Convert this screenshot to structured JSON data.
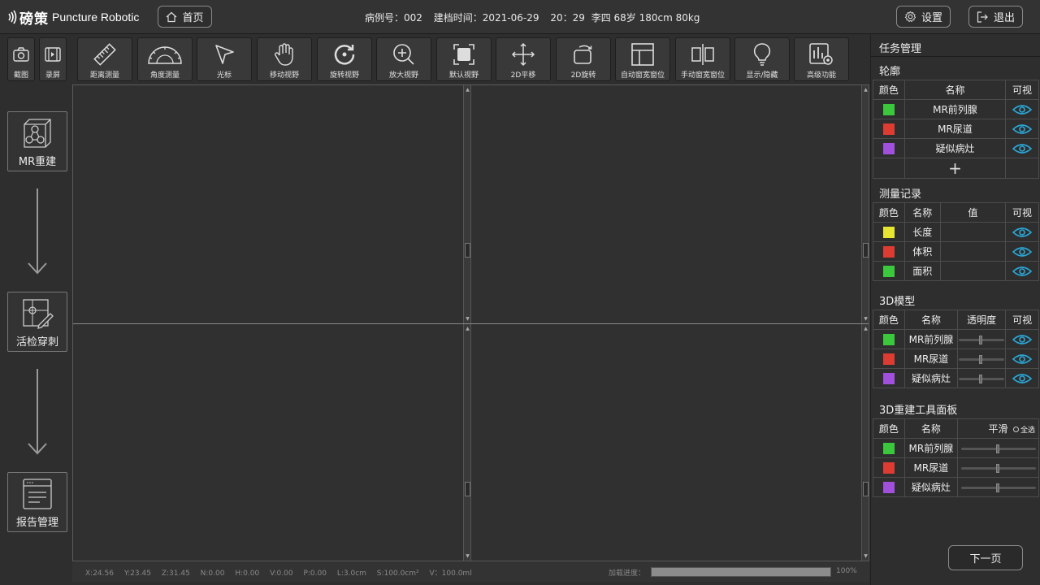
{
  "header": {
    "brand_cn": "磅策",
    "brand_en": "Puncture Robotic",
    "home_label": "首页",
    "patient": {
      "case": "病例号：002",
      "created": "建档时间：2021-06-29",
      "time": "20：29",
      "info": "李四 68岁 180cm 80kg"
    },
    "settings_label": "设置",
    "exit_label": "退出"
  },
  "toolbar": [
    {
      "label": "截图",
      "icon": "camera-icon"
    },
    {
      "label": "录屏",
      "icon": "film-icon"
    },
    {
      "label": "距离测量",
      "icon": "ruler-icon"
    },
    {
      "label": "角度测量",
      "icon": "protractor-icon"
    },
    {
      "label": "光标",
      "icon": "cursor-icon"
    },
    {
      "label": "移动视野",
      "icon": "hand-icon"
    },
    {
      "label": "旋转视野",
      "icon": "rotate-icon"
    },
    {
      "label": "放大视野",
      "icon": "zoom-in-icon"
    },
    {
      "label": "默认视野",
      "icon": "default-view-icon"
    },
    {
      "label": "2D平移",
      "icon": "move-arrows-icon"
    },
    {
      "label": "2D旋转",
      "icon": "rotate-2d-icon"
    },
    {
      "label": "自动窗宽窗位",
      "icon": "auto-window-icon"
    },
    {
      "label": "手动窗宽窗位",
      "icon": "manual-window-icon"
    },
    {
      "label": "显示/隐藏",
      "icon": "bulb-icon"
    },
    {
      "label": "高级功能",
      "icon": "advanced-settings-icon"
    }
  ],
  "workflow": [
    {
      "label": "MR重建",
      "icon": "mr-reconstruct-icon"
    },
    {
      "label": "活检穿刺",
      "icon": "biopsy-icon"
    },
    {
      "label": "报告管理",
      "icon": "report-icon"
    }
  ],
  "status": {
    "coords": [
      "X:24.56",
      "Y:23.45",
      "Z:31.45",
      "N:0.00",
      "H:0.00",
      "V:0.00",
      "P:0.00",
      "L:3.0cm",
      "S:100.0cm²",
      "V：100.0ml"
    ],
    "load_label": "加载进度：",
    "load_percent": "100%",
    "load_progress": 1.0
  },
  "panel": {
    "title": "任务管理",
    "contour": {
      "title": "轮廓",
      "headers": [
        "颜色",
        "名称",
        "可视"
      ],
      "rows": [
        {
          "color": "#3cc83c",
          "name": "MR前列腺"
        },
        {
          "color": "#dc3c32",
          "name": "MR尿道"
        },
        {
          "color": "#a050dc",
          "name": "疑似病灶"
        }
      ],
      "add": "+"
    },
    "measure": {
      "title": "测量记录",
      "headers": [
        "颜色",
        "名称",
        "值",
        "可视"
      ],
      "rows": [
        {
          "color": "#e6e632",
          "name": "长度",
          "value": ""
        },
        {
          "color": "#dc3c32",
          "name": "体积",
          "value": ""
        },
        {
          "color": "#3cc83c",
          "name": "面积",
          "value": ""
        }
      ]
    },
    "model3d": {
      "title": "3D模型",
      "headers": [
        "颜色",
        "名称",
        "透明度",
        "可视"
      ],
      "rows": [
        {
          "color": "#3cc83c",
          "name": "MR前列腺",
          "opacity": 0.5
        },
        {
          "color": "#dc3c32",
          "name": "MR尿道",
          "opacity": 0.5
        },
        {
          "color": "#a050dc",
          "name": "疑似病灶",
          "opacity": 0.5
        }
      ]
    },
    "tools3d": {
      "title": "3D重建工具面板",
      "headers": [
        "颜色",
        "名称",
        "平滑"
      ],
      "select_all": "全选",
      "rows": [
        {
          "color": "#3cc83c",
          "name": "MR前列腺",
          "smooth": 0.5
        },
        {
          "color": "#dc3c32",
          "name": "MR尿道",
          "smooth": 0.5
        },
        {
          "color": "#a050dc",
          "name": "疑似病灶",
          "smooth": 0.5
        }
      ]
    },
    "next_label": "下一页"
  },
  "colors": {
    "eye": "#2aa8d8",
    "background": "#2e2e2e"
  }
}
